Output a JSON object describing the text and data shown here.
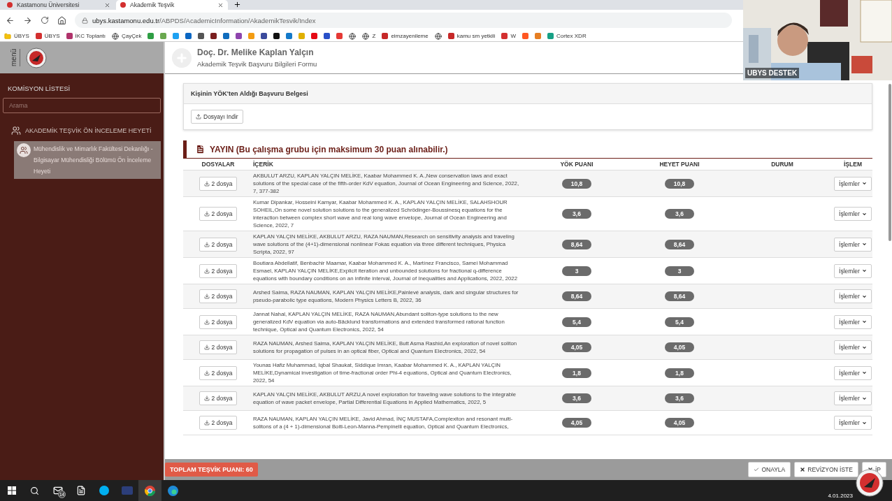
{
  "browser": {
    "tabs": [
      {
        "title": "Kastamonu Üniversitesi",
        "selected": false
      },
      {
        "title": "Akademik Teşvik",
        "selected": true
      }
    ],
    "url": {
      "host": "ubys.kastamonu.edu.tr",
      "path": "/ABPDS/AcademicInformation/AkademikTesvik/Index"
    },
    "bookmarks": [
      {
        "kind": "folder",
        "label": "ÜBYS"
      },
      {
        "kind": "site",
        "label": "ÜBYS",
        "color": "#d32f2f"
      },
      {
        "kind": "site",
        "label": "İKC Toplantı",
        "color": "#b0336b"
      },
      {
        "kind": "globe",
        "label": "ÇayÇek"
      },
      {
        "kind": "icon",
        "color": "#2e9e44"
      },
      {
        "kind": "icon",
        "color": "#6aa84f"
      },
      {
        "kind": "icon",
        "color": "#1da1f2"
      },
      {
        "kind": "icon",
        "color": "#0a66c2"
      },
      {
        "kind": "icon",
        "color": "#555555"
      },
      {
        "kind": "icon",
        "color": "#7a1f1f"
      },
      {
        "kind": "icon",
        "color": "#0f6cbd"
      },
      {
        "kind": "icon",
        "color": "#8e44ad"
      },
      {
        "kind": "icon",
        "color": "#f39c12"
      },
      {
        "kind": "icon",
        "color": "#3b4a9c"
      },
      {
        "kind": "icon",
        "color": "#111111"
      },
      {
        "kind": "icon",
        "color": "#1479c9"
      },
      {
        "kind": "icon",
        "color": "#e0b000"
      },
      {
        "kind": "icon",
        "color": "#e50914"
      },
      {
        "kind": "icon",
        "color": "#2850c8"
      },
      {
        "kind": "icon",
        "color": "#e53935"
      },
      {
        "kind": "globe"
      },
      {
        "kind": "globe",
        "label": "Z"
      },
      {
        "kind": "site",
        "label": "eimzayenileme",
        "color": "#c62828"
      },
      {
        "kind": "globe"
      },
      {
        "kind": "site",
        "label": "kamu sm yetkili",
        "color": "#c62828"
      },
      {
        "kind": "site",
        "label": "W",
        "color": "#d32f2f"
      },
      {
        "kind": "icon",
        "color": "#ff5722"
      },
      {
        "kind": "icon",
        "color": "#e67e22"
      },
      {
        "kind": "site",
        "label": "Cortex XDR",
        "color": "#16a085"
      }
    ]
  },
  "webcam": {
    "caption": "UBYS DESTEK"
  },
  "sidebar": {
    "menu_label": "menü",
    "title": "KOMİSYON LİSTESİ",
    "search": {
      "placeholder": "Arama"
    },
    "groups": [
      {
        "label": "AKADEMİK TEŞVİK ÖN İNCELEME HEYETİ",
        "expanded": true,
        "children": [
          {
            "label": "Mühendislik ve Mimarlık Fakültesi Dekanlığı - Bilgisayar Mühendisliği Bölümü Ön İnceleme Heyeti",
            "selected": true
          }
        ]
      }
    ]
  },
  "header": {
    "name": "Doç. Dr. Melike Kaplan Yalçın",
    "subtitle": "Akademik Teşvik Başvuru Bilgileri Formu"
  },
  "document_panel": {
    "title": "Kişinin YÖK'ten Aldığı Başvuru Belgesi",
    "button": "Dosyayı Indir"
  },
  "section": {
    "title": "YAYIN (Bu çalışma grubu için maksimum 30 puan alınabilir.)"
  },
  "table": {
    "columns": [
      "DOSYALAR",
      "İÇERİK",
      "YÖK PUANI",
      "HEYET PUANI",
      "DURUM",
      "İŞLEM"
    ],
    "rows": [
      {
        "files": "2 dosya",
        "content": "AKBULUT ARZU, KAPLAN YALÇIN MELİKE, Kaabar Mohammed K. A.,New conservation laws and exact solutions of the special case of the fifth-order KdV equation, Journal of Ocean Engineering and Science, 2022, 7, 377-382",
        "yok": "10,8",
        "heyet": "10,8",
        "action": "İşlemler"
      },
      {
        "files": "2 dosya",
        "content": "Kumar Dipankar, Hosseini Kamyar, Kaabar Mohammed K. A., KAPLAN YALÇIN MELİKE, SALAHSHOUR SOHEIL,On some novel solution solutions to the generalized Schrödinger-Boussinesq equations for the interaction between complex short wave and real long wave envelope, Journal of Ocean Engineering and Science, 2022, 7",
        "yok": "3,6",
        "heyet": "3,6",
        "action": "İşlemler"
      },
      {
        "files": "2 dosya",
        "content": "KAPLAN YALÇIN MELİKE, AKBULUT ARZU, RAZA NAUMAN,Research on sensitivity analysis and traveling wave solutions of the (4+1)-dimensional nonlinear Fokas equation via three different techniques, Physica Scripta, 2022, 97",
        "yok": "8,64",
        "heyet": "8,64",
        "action": "İşlemler"
      },
      {
        "files": "2 dosya",
        "content": "Boutiara Abdellatif, Benbachir Maamar, Kaabar Mohammed K. A., Martínez Francisco, Samei Mohammad Esmael, KAPLAN YALÇIN MELİKE,Explicit iteration and unbounded solutions for fractional q-difference equations with boundary conditions on an infinite interval, Journal of Inequalities and Applications, 2022, 2022",
        "yok": "3",
        "heyet": "3",
        "action": "İşlemler"
      },
      {
        "files": "2 dosya",
        "content": "Arshed Saima, RAZA NAUMAN, KAPLAN YALÇIN MELİKE,Painlevé analysis, dark and singular structures for pseudo-parabolic type equations, Modern Physics Letters B, 2022, 36",
        "yok": "8,64",
        "heyet": "8,64",
        "action": "İşlemler"
      },
      {
        "files": "2 dosya",
        "content": "Jannat Nahal, KAPLAN YALÇIN MELİKE, RAZA NAUMAN,Abundant soliton-type solutions to the new generalized KdV equation via auto-Bäcklund transformations and extended transformed rational function technique, Optical and Quantum Electronics, 2022, 54",
        "yok": "5,4",
        "heyet": "5,4",
        "action": "İşlemler"
      },
      {
        "files": "2 dosya",
        "content": "RAZA NAUMAN, Arshed Saima, KAPLAN YALÇIN MELİKE, Butt Asma Rashid,An exploration of novel soliton solutions for propagation of pulses in an optical fiber, Optical and Quantum Electronics, 2022, 54",
        "yok": "4,05",
        "heyet": "4,05",
        "action": "İşlemler"
      },
      {
        "files": "2 dosya",
        "content": "Younas Hafiz Muhammad, Iqbal Shaukat, Siddique Imran, Kaabar Mohammed K. A., KAPLAN YALÇIN MELİKE,Dynamical investigation of time-fractional order Phi-4 equations, Optical and Quantum Electronics, 2022, 54",
        "yok": "1,8",
        "heyet": "1,8",
        "action": "İşlemler"
      },
      {
        "files": "2 dosya",
        "content": "KAPLAN YALÇIN MELİKE, AKBULUT ARZU,A novel exploration for traveling wave solutions to the integrable equation of wave packet envelope, Partial Differential Equations in Applied Mathematics, 2022, 5",
        "yok": "3,6",
        "heyet": "3,6",
        "action": "İşlemler"
      },
      {
        "files": "2 dosya",
        "content": "RAZA NAUMAN, KAPLAN YALÇIN MELİKE, Javid Ahmad, İNÇ MUSTAFA,Complexiton and resonant multi-solitons of a (4 + 1)-dimensional Boiti-Leon-Manna-Pempinelli equation, Optical and Quantum Electronics,",
        "yok": "4,05",
        "heyet": "4,05",
        "action": "İşlemler"
      }
    ]
  },
  "footer": {
    "total": "TOPLAM TEŞVİK PUANI: 60",
    "buttons": [
      {
        "kind": "check",
        "label": "ONAYLA"
      },
      {
        "kind": "close",
        "label": "REVİZYON İSTE"
      },
      {
        "kind": "close",
        "label": "İP"
      }
    ]
  },
  "taskbar": {
    "apps": [
      {
        "kind": "mail",
        "badge": "14"
      },
      {
        "kind": "app"
      },
      {
        "kind": "skype"
      },
      {
        "kind": "ubys"
      },
      {
        "kind": "chrome",
        "selected": true
      },
      {
        "kind": "edge",
        "selected": false
      }
    ],
    "date": "4.01.2023"
  }
}
